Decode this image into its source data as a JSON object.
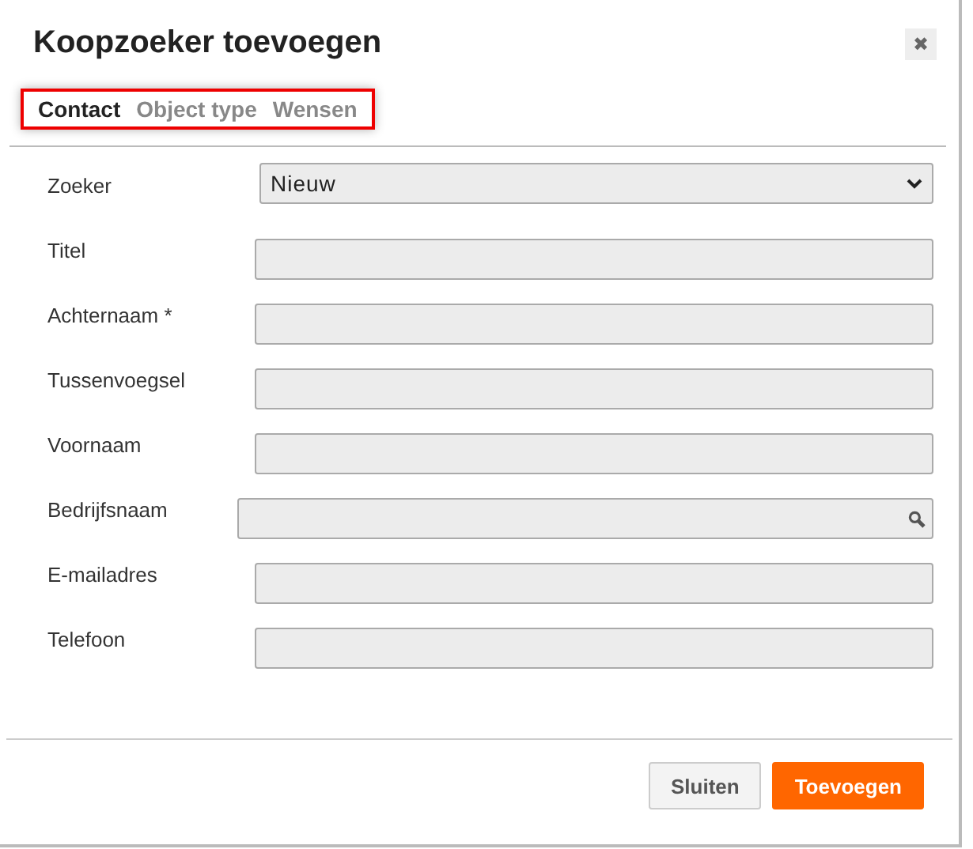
{
  "dialog": {
    "title": "Koopzoeker toevoegen",
    "close": "✖"
  },
  "tab_bar": {
    "highlighted": true,
    "tabs": [
      {
        "label": "Contact",
        "selected": true
      },
      {
        "label": "Object type",
        "selected": false
      },
      {
        "label": "Wensen",
        "selected": false
      }
    ]
  },
  "fields": [
    {
      "label": "Zoeker",
      "kind": "select",
      "value": "Nieuw"
    },
    {
      "label": "Titel",
      "kind": "text"
    },
    {
      "label": "Achternaam *",
      "kind": "text"
    },
    {
      "label": "Tussenvoegsel",
      "kind": "text"
    },
    {
      "label": "Voornaam",
      "kind": "text"
    },
    {
      "label": "Bedrijfsnaam",
      "kind": "search"
    },
    {
      "label": "E-mailadres",
      "kind": "text"
    },
    {
      "label": "Telefoon",
      "kind": "text"
    }
  ],
  "buttons": [
    {
      "label": "Sluiten",
      "kind": "secondary"
    },
    {
      "label": "Toevoegen",
      "kind": "primary"
    }
  ]
}
